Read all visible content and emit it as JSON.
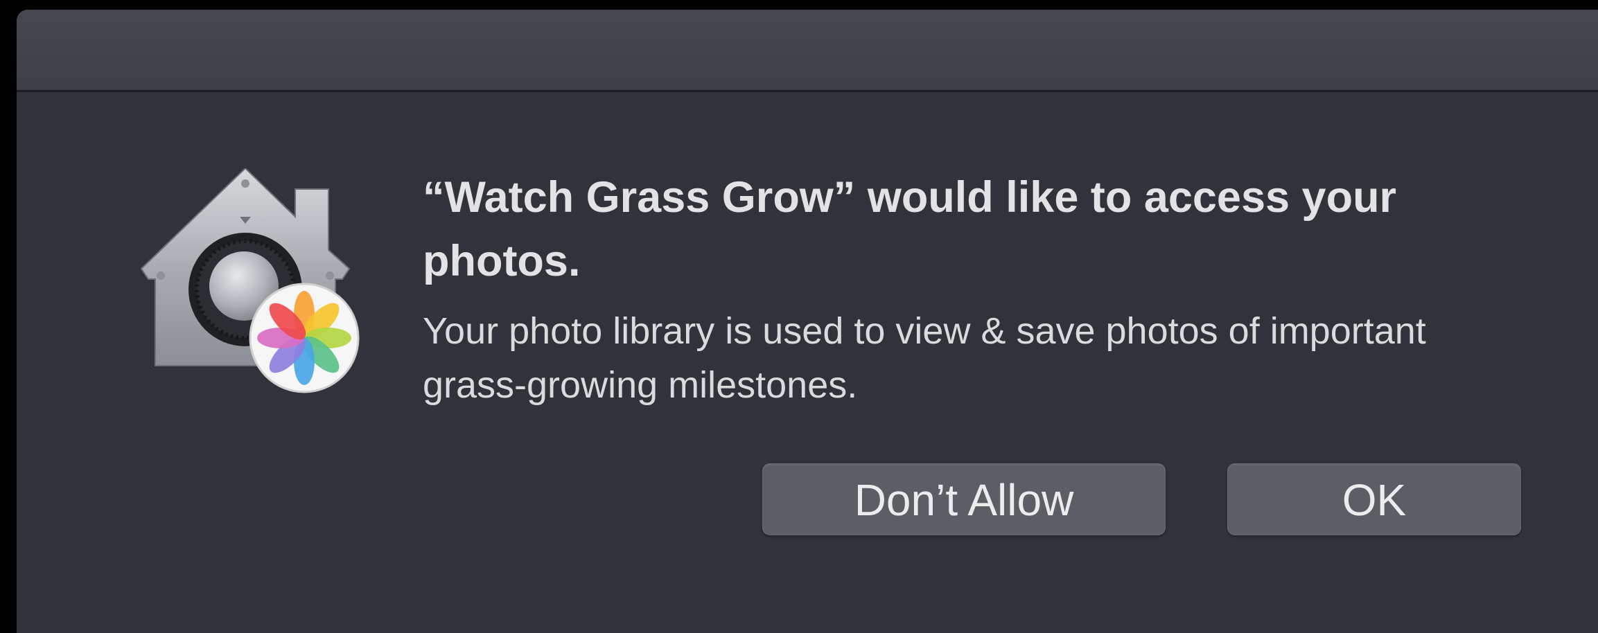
{
  "dialog": {
    "title": "“Watch Grass Grow” would like to access your photos.",
    "message": "Your photo library is used to view & save photos of important grass-growing milestones.",
    "icon": "security-vault-house-icon",
    "badge_icon": "photos-app-icon"
  },
  "buttons": {
    "deny_label": "Don’t Allow",
    "ok_label": "OK"
  },
  "colors": {
    "window_background": "#30333a",
    "titlebar": "#414449",
    "button_background": "#5b5e64",
    "text_primary": "#e3e3e5"
  }
}
